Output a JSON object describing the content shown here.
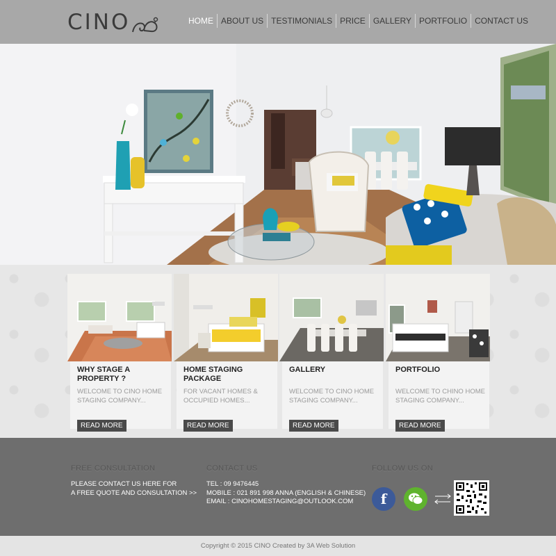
{
  "header": {
    "logo_text": "CINO",
    "nav": [
      "HOME",
      "ABOUT US",
      "TESTIMONIALS",
      "PRICE",
      "GALLERY",
      "PORTFOLIO",
      "CONTACT US"
    ]
  },
  "hero": {
    "slide_count": 5,
    "active_slide": 1
  },
  "cards": [
    {
      "title": "WHY STAGE A PROPERTY ?",
      "desc": "WELCOME TO CINO HOME STAGING COMPANY...",
      "button": "READ MORE"
    },
    {
      "title": "HOME STAGING PACKAGE",
      "desc": "FOR VACANT HOMES & OCCUPIED HOMES...",
      "button": "READ MORE"
    },
    {
      "title": "GALLERY",
      "desc": "WELCOME TO CINO HOME STAGING COMPANY...",
      "button": "READ MORE"
    },
    {
      "title": "PORTFOLIO",
      "desc": "WELCOME TO CHINO HOME STAGING COMPANY...",
      "button": "READ MORE"
    }
  ],
  "footer": {
    "consult_heading": "FREE CONSULTATION",
    "consult_line1": "PLEASE CONTACT US HERE FOR",
    "consult_line2": "A FREE QUOTE AND CONSULTATION >>",
    "contact_heading": "CONTACT US",
    "tel": "TEL : 09 9476445",
    "mobile": "MOBILE : 021 891 998 ANNA (ENGLISH & CHINESE)",
    "email": "EMAIL : CINOHOMESTAGING@OUTLOOK.COM",
    "follow_heading": "FOLLOW US ON",
    "facebook_glyph": "f"
  },
  "copyright": "Copyright © 2015 CINO Created by 3A Web Solution",
  "colors": {
    "header_bg": "#a8a8a8",
    "footer_bg": "#6e6e6e",
    "button_bg": "#4a4a4a",
    "facebook": "#3c5a99",
    "wechat": "#5fb32e"
  }
}
